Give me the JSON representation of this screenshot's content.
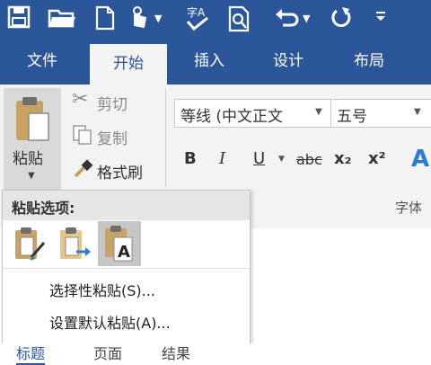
{
  "colors": {
    "brand": "#2b579a",
    "ribbon_bg": "#f3f3f3"
  },
  "quick_access": {
    "icons": [
      "save-icon",
      "open-folder-icon",
      "new-document-icon",
      "touch-mode-icon",
      "spelling-icon",
      "print-preview-icon",
      "undo-icon",
      "redo-icon",
      "customize-icon"
    ]
  },
  "tabs": [
    "文件",
    "开始",
    "插入",
    "设计",
    "布局"
  ],
  "clipboard": {
    "paste": "粘贴",
    "cut": "剪切",
    "copy": "复制",
    "format_painter": "格式刷"
  },
  "font": {
    "family": "等线 (中文正文",
    "size": "五号",
    "bold": "B",
    "italic": "I",
    "underline": "U",
    "strike": "abc",
    "subscript": "x₂",
    "superscript": "x²",
    "group_label": "字体"
  },
  "paste_menu": {
    "header": "粘贴选项:",
    "options": [
      "keep-source-formatting-icon",
      "merge-formatting-icon",
      "keep-text-only-icon"
    ],
    "paste_special": "选择性粘贴(S)...",
    "set_default": "设置默认粘贴(A)..."
  },
  "bottom_tabs": [
    "标题",
    "页面",
    "结果"
  ]
}
